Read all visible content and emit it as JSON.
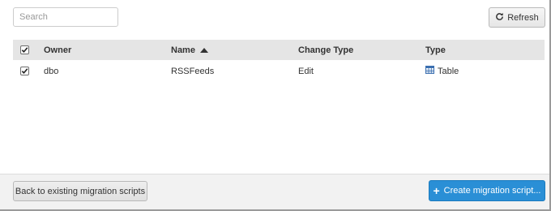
{
  "search": {
    "placeholder": "Search",
    "value": ""
  },
  "toolbar": {
    "refresh_label": "Refresh",
    "refresh_icon": "refresh-icon"
  },
  "table": {
    "columns": {
      "owner": "Owner",
      "name": "Name",
      "change_type": "Change Type",
      "type": "Type"
    },
    "sort": {
      "column": "name",
      "direction": "ascending"
    },
    "header_checkbox_checked": true,
    "rows": [
      {
        "checked": true,
        "owner": "dbo",
        "name": "RSSFeeds",
        "change_type": "Edit",
        "type": "Table",
        "type_icon": "table-icon"
      }
    ]
  },
  "footer": {
    "back_label": "Back to existing migration scripts",
    "create_label": "Create migration script...",
    "create_icon": "plus-icon"
  },
  "colors": {
    "header_bg": "#e5e5e5",
    "footer_bg": "#f2f2f2",
    "primary": "#2a8fd6"
  }
}
